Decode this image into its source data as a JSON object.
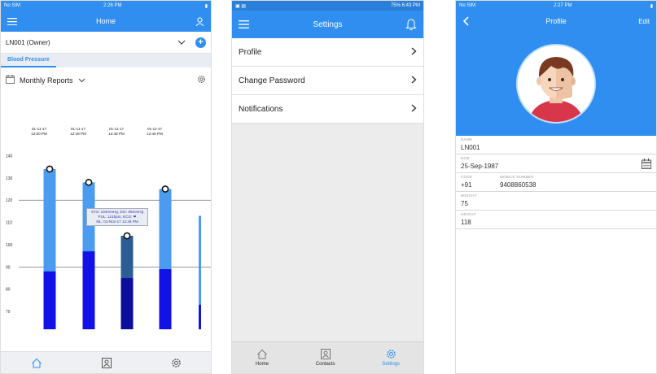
{
  "home": {
    "status": {
      "carrier": "No SIM",
      "time": "2:26 PM"
    },
    "title": "Home",
    "account": "LN001 (Owner)",
    "tab": "Blood Pressure",
    "report_label": "Monthly Reports",
    "tooltip": {
      "line1": "SYS: 104mmHg, DIA: 85mmHg",
      "line2": "PUL: 121bpm, ECG: ❤",
      "line3": "ML: 01-Nov-17 12:49 PM"
    }
  },
  "settings": {
    "status": {
      "time": "6:43 PM",
      "battery": "75%"
    },
    "title": "Settings",
    "items": [
      {
        "label": "Profile"
      },
      {
        "label": "Change Password"
      },
      {
        "label": "Notifications"
      }
    ],
    "nav": [
      {
        "label": "Home",
        "icon": "home-icon"
      },
      {
        "label": "Contacts",
        "icon": "contacts-icon"
      },
      {
        "label": "Settings",
        "icon": "settings-icon"
      }
    ]
  },
  "profile": {
    "status": {
      "carrier": "No SIM",
      "time": "2:27 PM"
    },
    "title": "Profile",
    "edit_label": "Edit",
    "name_label": "NAME",
    "name": "LN001",
    "dob_label": "DOB",
    "dob": "25-Sep-1987",
    "code_label": "CODE",
    "code": "+91",
    "mobile_label": "MOBILE NUMBER",
    "mobile": "9408860538",
    "weight_label": "WEIGHT",
    "weight": "75",
    "height_label": "HEIGHT",
    "height": "118"
  },
  "chart_data": {
    "type": "bar",
    "categories": [
      "01-11-17 12:50 PM",
      "01-11-17 12:49 PM",
      "01-11-17 12:48 PM",
      "01-11-17 12:45 PM"
    ],
    "series": [
      {
        "values": [
          134,
          128,
          104,
          125
        ]
      },
      {
        "values": [
          88,
          97,
          85,
          89
        ]
      }
    ],
    "partial_bar": {
      "top": 113,
      "bottom": 73
    },
    "yticks": [
      140,
      130,
      120,
      110,
      100,
      90,
      80,
      70
    ],
    "ylim": [
      62,
      142
    ],
    "reference_lines": [
      120,
      90
    ],
    "colors": {
      "upper": [
        "#4b9cf0",
        "#4b9cf0",
        "#2a5d93",
        "#4b9cf0"
      ],
      "lower": [
        "#1212e6",
        "#1212e6",
        "#0d0d9e",
        "#1212e6"
      ]
    }
  }
}
